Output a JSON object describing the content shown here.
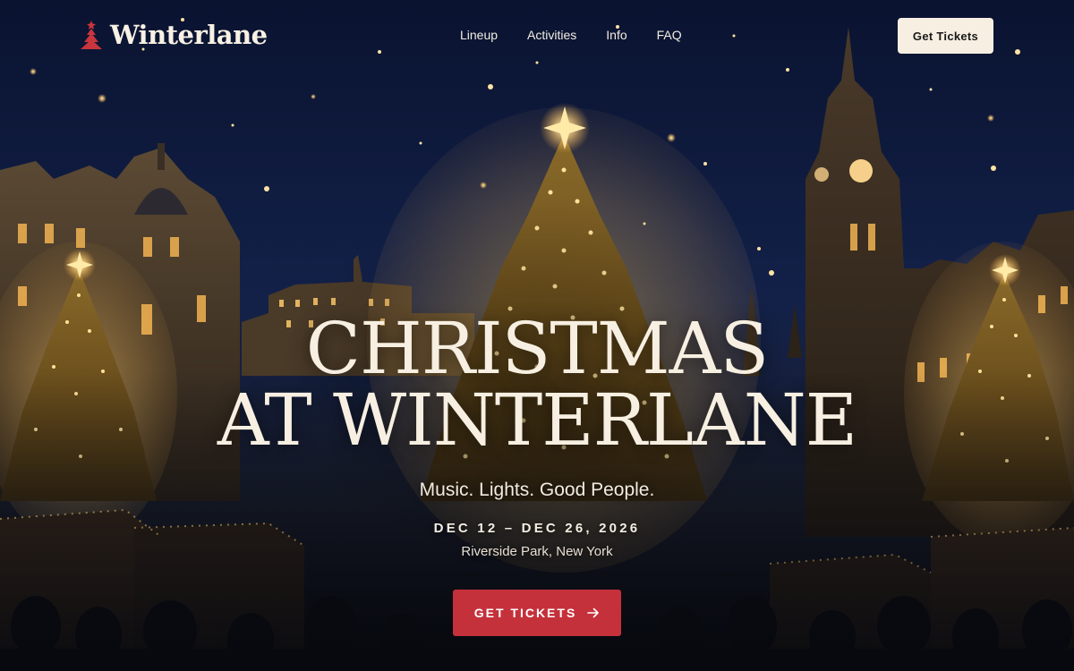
{
  "brand": {
    "name": "Winterlane",
    "logo_icon": "christmas-tree-icon",
    "logo_color": "#c8353d"
  },
  "nav": {
    "links": [
      "Lineup",
      "Activities",
      "Info",
      "FAQ"
    ],
    "cta_label": "Get Tickets"
  },
  "hero": {
    "title_line1": "CHRISTMAS",
    "title_line2": "AT WINTERLANE",
    "subtitle": "Music. Lights. Good People.",
    "dates": "DEC 12 – DEC 26, 2026",
    "location": "Riverside Park, New York",
    "cta_label": "GET TICKETS",
    "cta_icon": "arrow-right-icon",
    "cta_color": "#c5313b"
  },
  "background": {
    "description_icon": "night-christmas-market-scene",
    "sky_color": "#0f1a3d",
    "light_color": "#f7c15a"
  }
}
